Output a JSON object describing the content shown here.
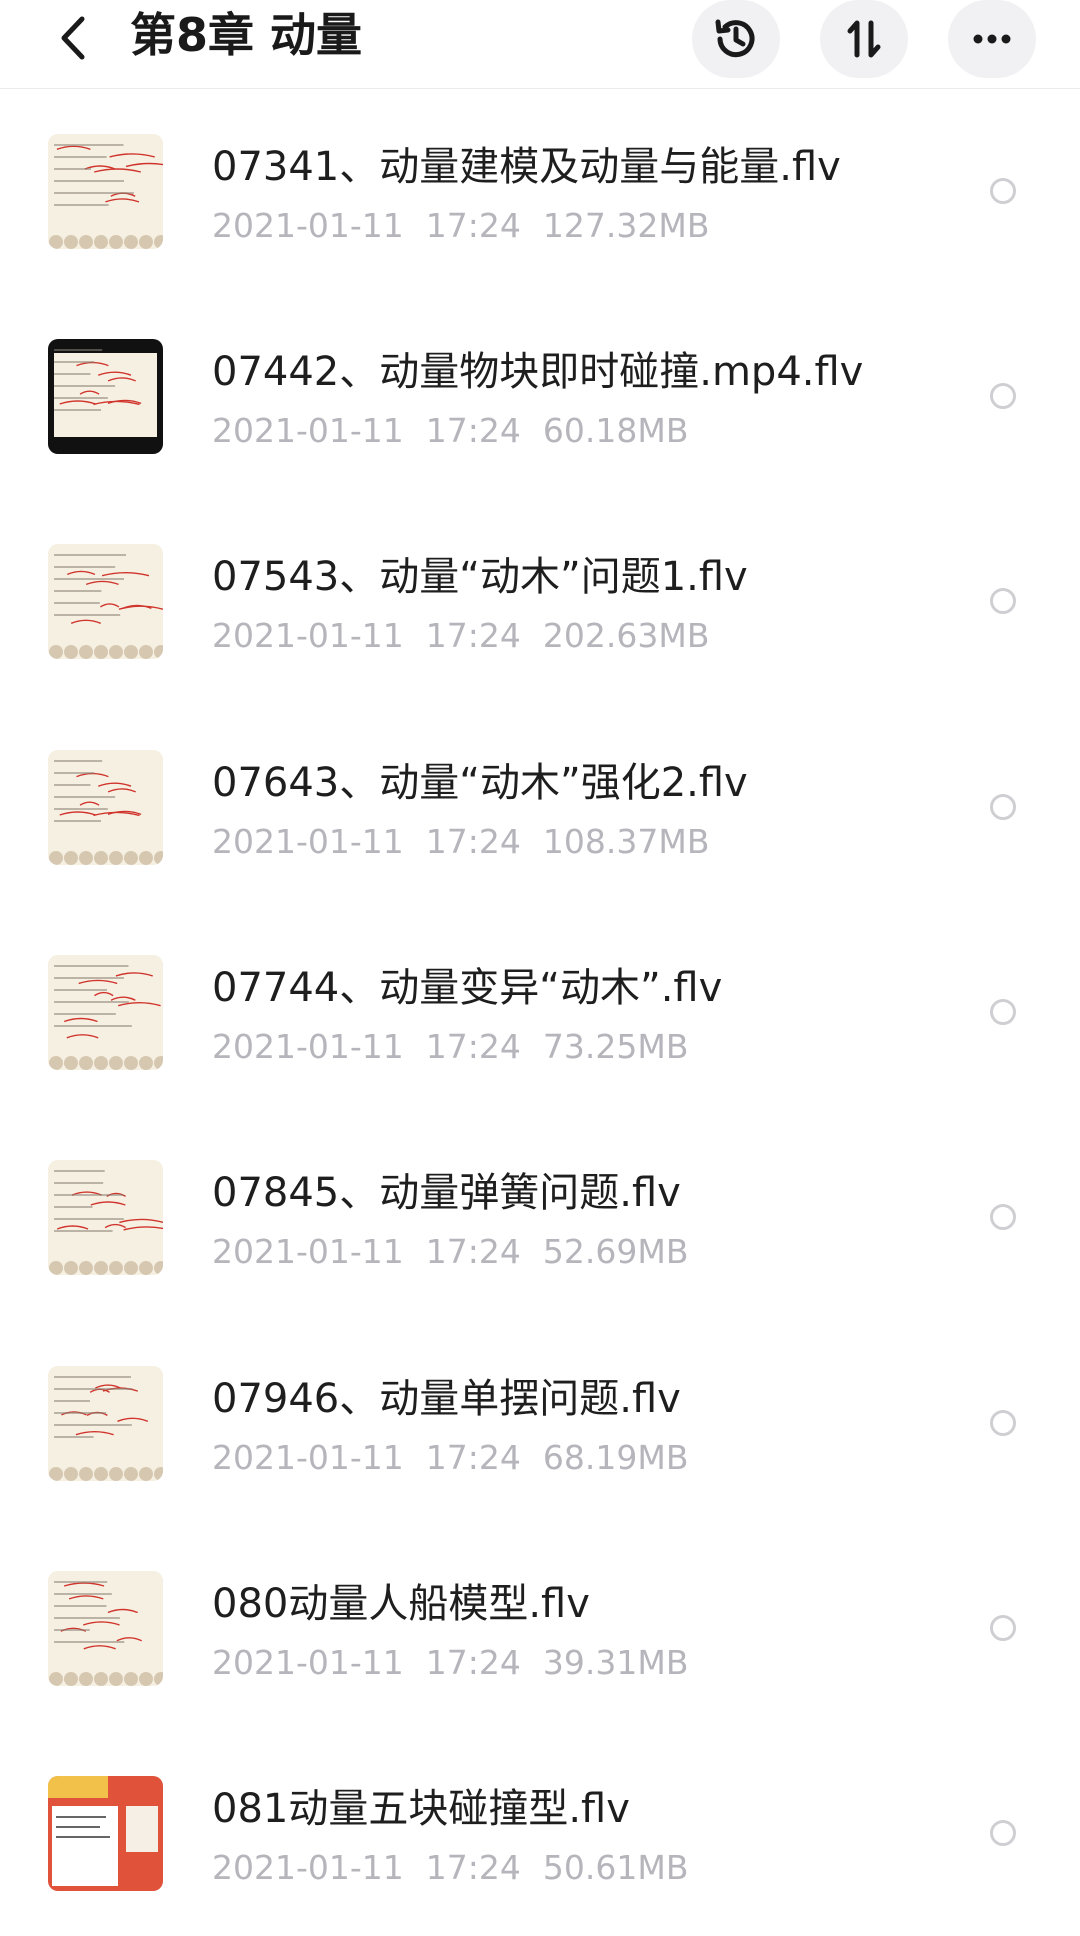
{
  "header": {
    "title": "第8章 动量",
    "back_icon": "chevron-left-icon",
    "history_icon": "history-icon",
    "sort_icon": "sort-icon",
    "more_icon": "more-horizontal-icon"
  },
  "files": [
    {
      "name": "07341、动量建模及动量与能量.flv",
      "date": "2021-01-11",
      "time": "17:24",
      "size": "127.32MB",
      "thumb": "cream"
    },
    {
      "name": "07442、动量物块即时碰撞.mp4.flv",
      "date": "2021-01-11",
      "time": "17:24",
      "size": "60.18MB",
      "thumb": "dark"
    },
    {
      "name": "07543、动量“动木”问题1.flv",
      "date": "2021-01-11",
      "time": "17:24",
      "size": "202.63MB",
      "thumb": "cream"
    },
    {
      "name": "07643、动量“动木”强化2.flv",
      "date": "2021-01-11",
      "time": "17:24",
      "size": "108.37MB",
      "thumb": "cream"
    },
    {
      "name": "07744、动量变异“动木”.flv",
      "date": "2021-01-11",
      "time": "17:24",
      "size": "73.25MB",
      "thumb": "cream"
    },
    {
      "name": "07845、动量弹簧问题.flv",
      "date": "2021-01-11",
      "time": "17:24",
      "size": "52.69MB",
      "thumb": "cream"
    },
    {
      "name": "07946、动量单摆问题.flv",
      "date": "2021-01-11",
      "time": "17:24",
      "size": "68.19MB",
      "thumb": "cream"
    },
    {
      "name": "080动量人船模型.flv",
      "date": "2021-01-11",
      "time": "17:24",
      "size": "39.31MB",
      "thumb": "cream"
    },
    {
      "name": "081动量五块碰撞型.flv",
      "date": "2021-01-11",
      "time": "17:24",
      "size": "50.61MB",
      "thumb": "orange"
    }
  ],
  "colors": {
    "meta_text": "#b5b5bb",
    "circle_button_bg": "#f1f1f3",
    "thumb_cream": "#f6f0e2",
    "thumb_orange": "#e0533a",
    "annotation_red": "#d0342c"
  }
}
